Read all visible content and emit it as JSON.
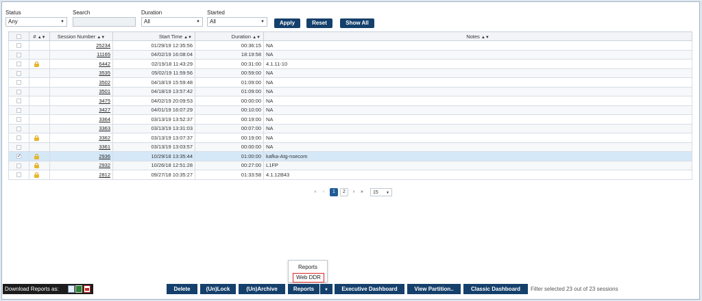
{
  "filters": {
    "status": {
      "label": "Status",
      "value": "Any"
    },
    "search": {
      "label": "Search",
      "value": ""
    },
    "duration": {
      "label": "Duration",
      "value": "All"
    },
    "started": {
      "label": "Started",
      "value": "All"
    },
    "apply_label": "Apply",
    "reset_label": "Reset",
    "showall_label": "Show All"
  },
  "table": {
    "headers": {
      "lock": "#",
      "session": "Session Number",
      "start": "Start Time",
      "duration": "Duration",
      "notes": "Notes"
    },
    "rows": [
      {
        "checked": false,
        "locked": false,
        "session": "25234",
        "start": "01/29/19 12:35:56",
        "duration": "00:36:15",
        "notes": "NA"
      },
      {
        "checked": false,
        "locked": false,
        "session": "11165",
        "start": "04/02/19 16:08:04",
        "duration": "18:19:58",
        "notes": "NA"
      },
      {
        "checked": false,
        "locked": true,
        "session": "6442",
        "start": "02/19/18 11:43:29",
        "duration": "00:31:00",
        "notes": "4.1.11-10"
      },
      {
        "checked": false,
        "locked": false,
        "session": "3535",
        "start": "05/02/19 11:59:56",
        "duration": "00:59:00",
        "notes": "NA"
      },
      {
        "checked": false,
        "locked": false,
        "session": "3502",
        "start": "04/18/19 15:59:48",
        "duration": "01:09:00",
        "notes": "NA"
      },
      {
        "checked": false,
        "locked": false,
        "session": "3501",
        "start": "04/18/19 13:57:42",
        "duration": "01:09:00",
        "notes": "NA"
      },
      {
        "checked": false,
        "locked": false,
        "session": "3475",
        "start": "04/02/19 20:09:53",
        "duration": "00:00:00",
        "notes": "NA"
      },
      {
        "checked": false,
        "locked": false,
        "session": "3427",
        "start": "04/01/19 16:07:29",
        "duration": "00:10:00",
        "notes": "NA"
      },
      {
        "checked": false,
        "locked": false,
        "session": "3364",
        "start": "03/13/19 13:52:37",
        "duration": "00:19:00",
        "notes": "NA"
      },
      {
        "checked": false,
        "locked": false,
        "session": "3363",
        "start": "03/13/19 13:31:03",
        "duration": "00:07:00",
        "notes": "NA"
      },
      {
        "checked": false,
        "locked": true,
        "session": "3362",
        "start": "03/13/19 13:07:37",
        "duration": "00:19:00",
        "notes": "NA"
      },
      {
        "checked": false,
        "locked": false,
        "session": "3361",
        "start": "03/13/19 13:03:57",
        "duration": "00:00:00",
        "notes": "NA"
      },
      {
        "checked": true,
        "locked": true,
        "session": "2936",
        "start": "10/29/18 13:35:44",
        "duration": "01:00:00",
        "notes": "kafka-Atg-nsecom"
      },
      {
        "checked": false,
        "locked": true,
        "session": "2932",
        "start": "10/26/18 12:51:28",
        "duration": "00:27:00",
        "notes": "L1FP"
      },
      {
        "checked": false,
        "locked": true,
        "session": "2812",
        "start": "09/27/18 10:35:27",
        "duration": "01:33:58",
        "notes": "4.1.12B43"
      }
    ]
  },
  "pager": {
    "first": "«",
    "prev": "‹",
    "current": "1",
    "page2": "2",
    "next": "›",
    "last": "»",
    "page_size": "15"
  },
  "popup": {
    "item1": "Reports",
    "item2": "Web DDR"
  },
  "bottom": {
    "download_label": "Download Reports as:",
    "delete": "Delete",
    "unlock": "(Un)Lock",
    "unarchive": "(Un)Archive",
    "reports": "Reports",
    "exec_dashboard": "Executive Dashboard",
    "view_partition": "View Partition..",
    "classic_dashboard": "Classic Dashboard",
    "status_text": "Filter selected 23 out of 23 sessions"
  },
  "icons": {
    "sort": "sort-arrows-icon",
    "dropdown": "chevron-down-icon",
    "lock": "padlock-icon",
    "excel": "excel-icon",
    "csv": "csv-icon",
    "pdf": "pdf-icon"
  },
  "colors": {
    "primary_button": "#15406c",
    "selected_row": "#d5e8f7",
    "lock": "#e7b62a",
    "highlight": "#dd2222"
  }
}
